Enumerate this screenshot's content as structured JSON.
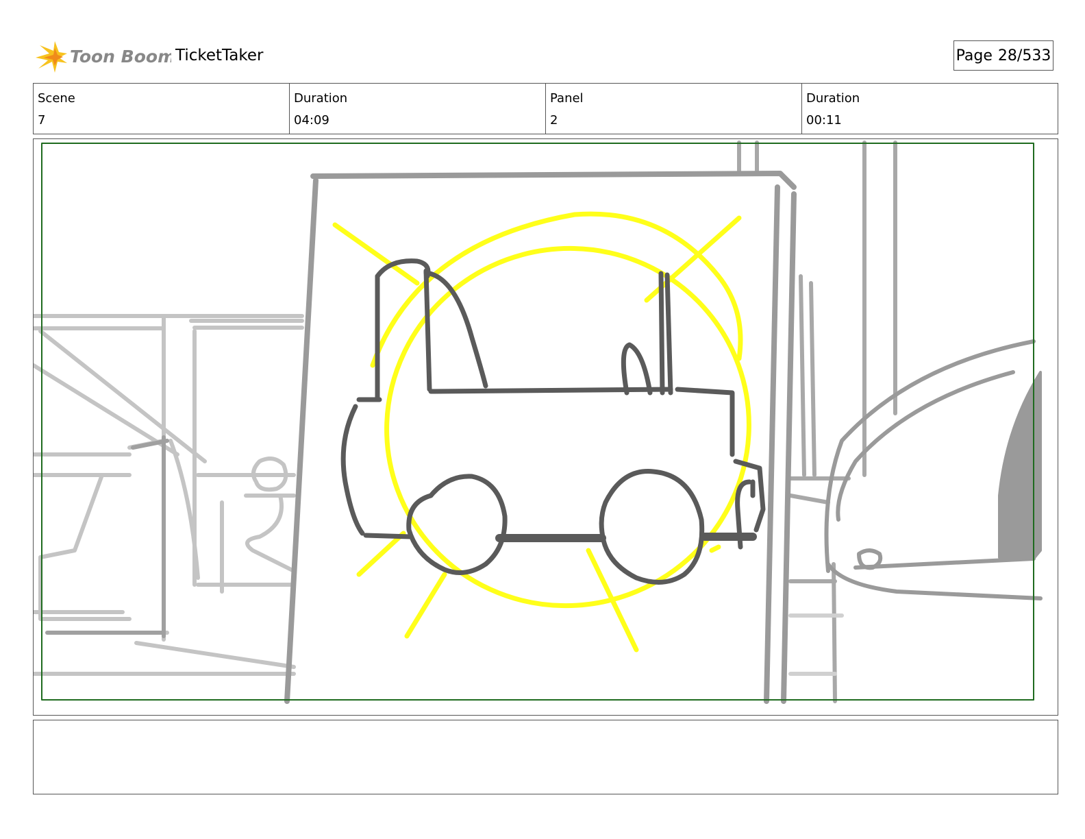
{
  "header": {
    "brand": "Toon Boom",
    "project_title": "TicketTaker",
    "page_label": "Page",
    "page_value": "28/533"
  },
  "info": {
    "scene_label": "Scene",
    "scene_value": "7",
    "scene_duration_label": "Duration",
    "scene_duration_value": "04:09",
    "panel_label": "Panel",
    "panel_value": "2",
    "panel_duration_label": "Duration",
    "panel_duration_value": "00:11"
  },
  "notes": {
    "text": ""
  },
  "colors": {
    "safe_frame": "#1f6b1f",
    "sketch_dark": "#5a5a5a",
    "sketch_mid": "#9a9a9a",
    "sketch_light": "#c4c4c4",
    "highlight": "#ffff1a",
    "logo_orange": "#f4a71d"
  }
}
